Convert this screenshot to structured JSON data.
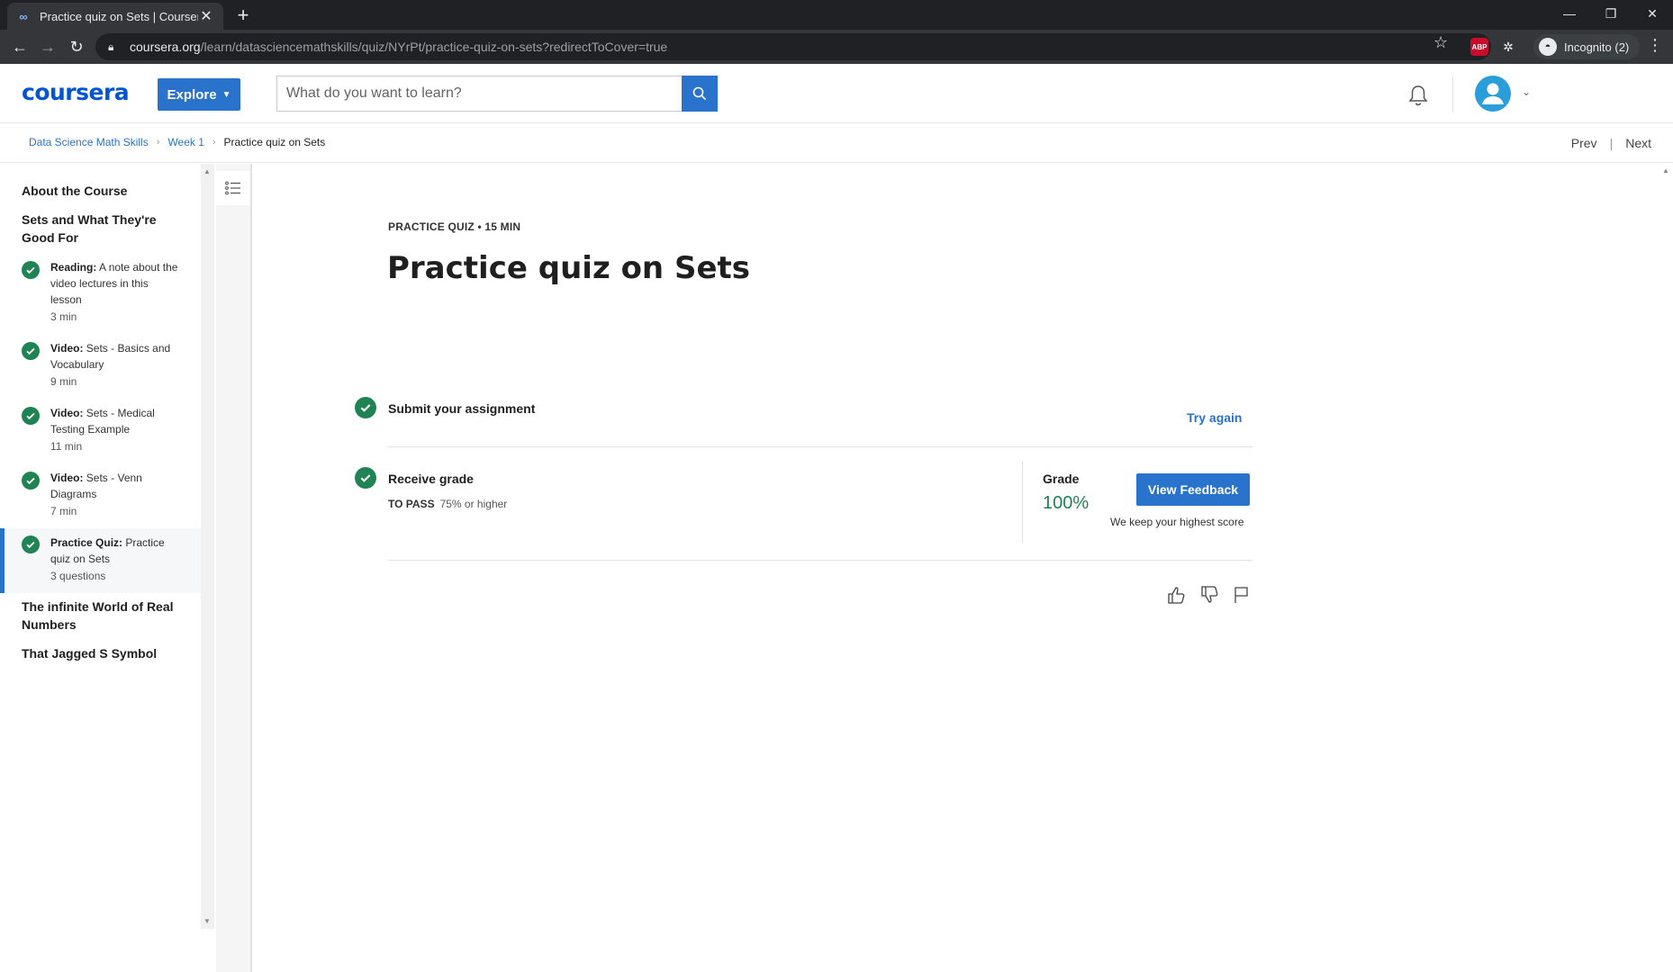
{
  "browser": {
    "tab_title": "Practice quiz on Sets | Coursera",
    "url_host": "coursera.org",
    "url_path": "/learn/datasciencemathskills/quiz/NYrPt/practice-quiz-on-sets?redirectToCover=true",
    "incognito_label": "Incognito (2)",
    "ext_abp_label": "ABP"
  },
  "header": {
    "logo": "coursera",
    "explore_label": "Explore",
    "search_placeholder": "What do you want to learn?"
  },
  "breadcrumb": {
    "items": [
      "Data Science Math Skills",
      "Week 1"
    ],
    "current": "Practice quiz on Sets",
    "prev": "Prev",
    "next": "Next"
  },
  "sidebar": {
    "sections": [
      "About the Course",
      "Sets and What They're Good For",
      "The infinite World of Real Numbers",
      "That Jagged S Symbol"
    ],
    "items": [
      {
        "type": "Reading:",
        "title": "A note about the video lectures in this lesson",
        "duration": "3 min"
      },
      {
        "type": "Video:",
        "title": "Sets - Basics and Vocabulary",
        "duration": "9 min"
      },
      {
        "type": "Video:",
        "title": "Sets - Medical Testing Example",
        "duration": "11 min"
      },
      {
        "type": "Video:",
        "title": "Sets - Venn Diagrams",
        "duration": "7 min"
      },
      {
        "type": "Practice Quiz:",
        "title": "Practice quiz on Sets",
        "duration": "3 questions"
      }
    ]
  },
  "main": {
    "eyebrow": "PRACTICE QUIZ • 15 MIN",
    "title": "Practice quiz on Sets",
    "submit_label": "Submit your assignment",
    "try_again": "Try again",
    "receive_label": "Receive grade",
    "to_pass_label": "TO PASS",
    "to_pass_value": "75% or higher",
    "grade_label": "Grade",
    "grade_value": "100%",
    "view_feedback": "View Feedback",
    "keep_note": "We keep your highest score"
  },
  "colors": {
    "brand": "#0056d2",
    "button": "#2a73cc",
    "success": "#1f8354"
  }
}
